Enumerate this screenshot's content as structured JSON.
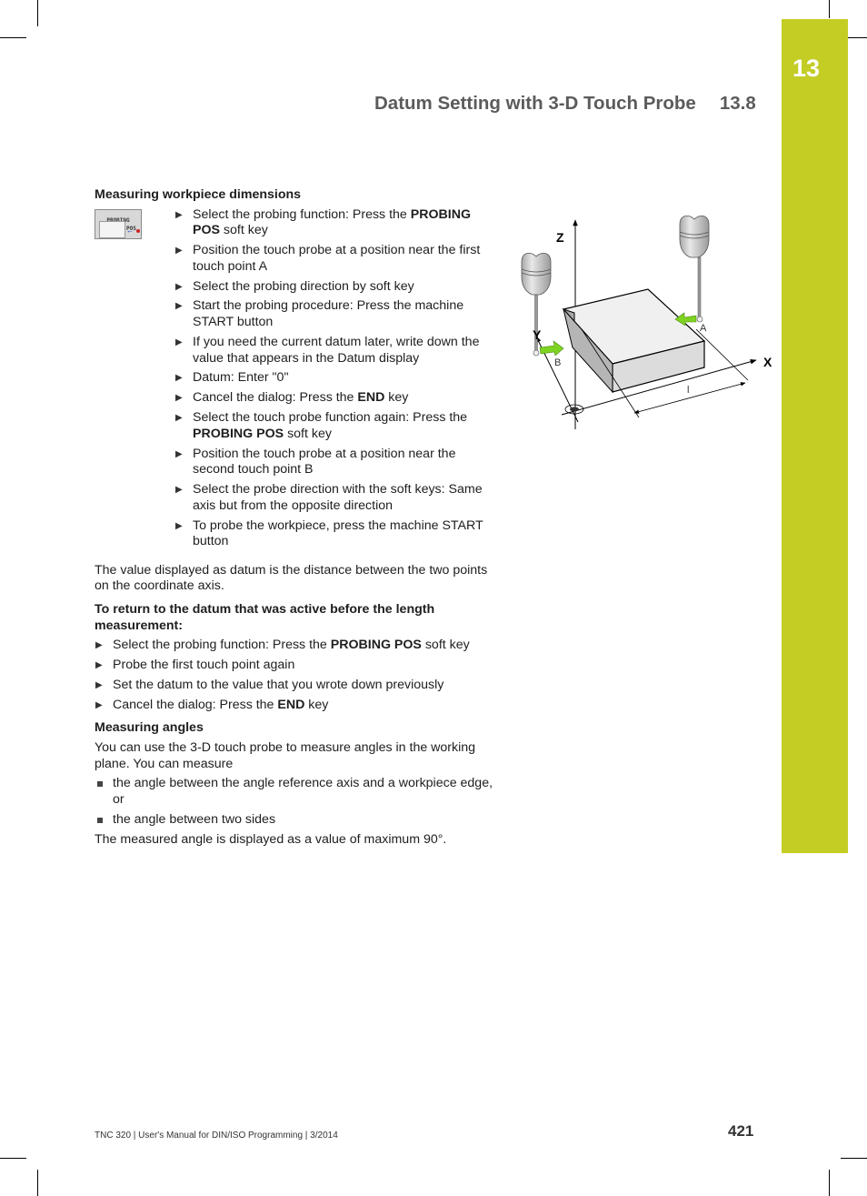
{
  "chapter_tab": {
    "number": "13",
    "color": "#c3cd24"
  },
  "header": {
    "title": "Datum Setting with 3-D Touch Probe",
    "section": "13.8"
  },
  "section1": {
    "heading": "Measuring workpiece dimensions",
    "softkey": {
      "line1": "PROBING",
      "line2": "POS",
      "icon": "probing-pos-softkey-icon"
    },
    "steps": [
      {
        "pre": "Select the probing function: Press the ",
        "kw": "PROBING POS",
        "post": " soft key"
      },
      {
        "pre": "Position the touch probe at a position near the first touch point A",
        "kw": "",
        "post": ""
      },
      {
        "pre": "Select the probing direction by soft key",
        "kw": "",
        "post": ""
      },
      {
        "pre": "Start the probing procedure: Press the machine START button",
        "kw": "",
        "post": ""
      },
      {
        "pre": "If you need the current datum later, write down the value that appears in the Datum display",
        "kw": "",
        "post": ""
      },
      {
        "pre": "Datum: Enter \"0\"",
        "kw": "",
        "post": ""
      },
      {
        "pre": "Cancel the dialog: Press the ",
        "kw": "END",
        "post": " key"
      },
      {
        "pre": "Select the touch probe function again: Press the ",
        "kw": "PROBING POS",
        "post": " soft key"
      },
      {
        "pre": "Position the touch probe at a position near the second touch point B",
        "kw": "",
        "post": ""
      },
      {
        "pre": "Select the probe direction with the soft keys: Same axis but from the opposite direction",
        "kw": "",
        "post": ""
      },
      {
        "pre": "To probe the workpiece, press the machine START button",
        "kw": "",
        "post": ""
      }
    ],
    "note": "The value displayed as datum is the distance between the two points on the coordinate axis."
  },
  "section2": {
    "heading": "To return to the datum that was active before the length measurement:",
    "steps": [
      {
        "pre": "Select the probing function: Press the ",
        "kw": "PROBING POS",
        "post": " soft key"
      },
      {
        "pre": "Probe the first touch point again",
        "kw": "",
        "post": ""
      },
      {
        "pre": "Set the datum to the value that you wrote down previously",
        "kw": "",
        "post": ""
      },
      {
        "pre": "Cancel the dialog: Press the ",
        "kw": "END",
        "post": " key"
      }
    ]
  },
  "section3": {
    "heading": "Measuring angles",
    "intro": "You can use the 3-D touch probe to measure angles in the working plane. You can measure",
    "bullets": [
      "the angle between the angle reference axis and a workpiece edge, or",
      "the angle between two sides"
    ],
    "note": "The measured angle is displayed as a value of maximum 90°."
  },
  "figure": {
    "labels": {
      "z": "Z",
      "y": "Y",
      "x": "X",
      "a": "A",
      "b": "B",
      "l": "l"
    },
    "arrow_color": "#7ed321"
  },
  "footer": {
    "text": "TNC 320 | User's Manual for DIN/ISO Programming | 3/2014",
    "page": "421"
  }
}
